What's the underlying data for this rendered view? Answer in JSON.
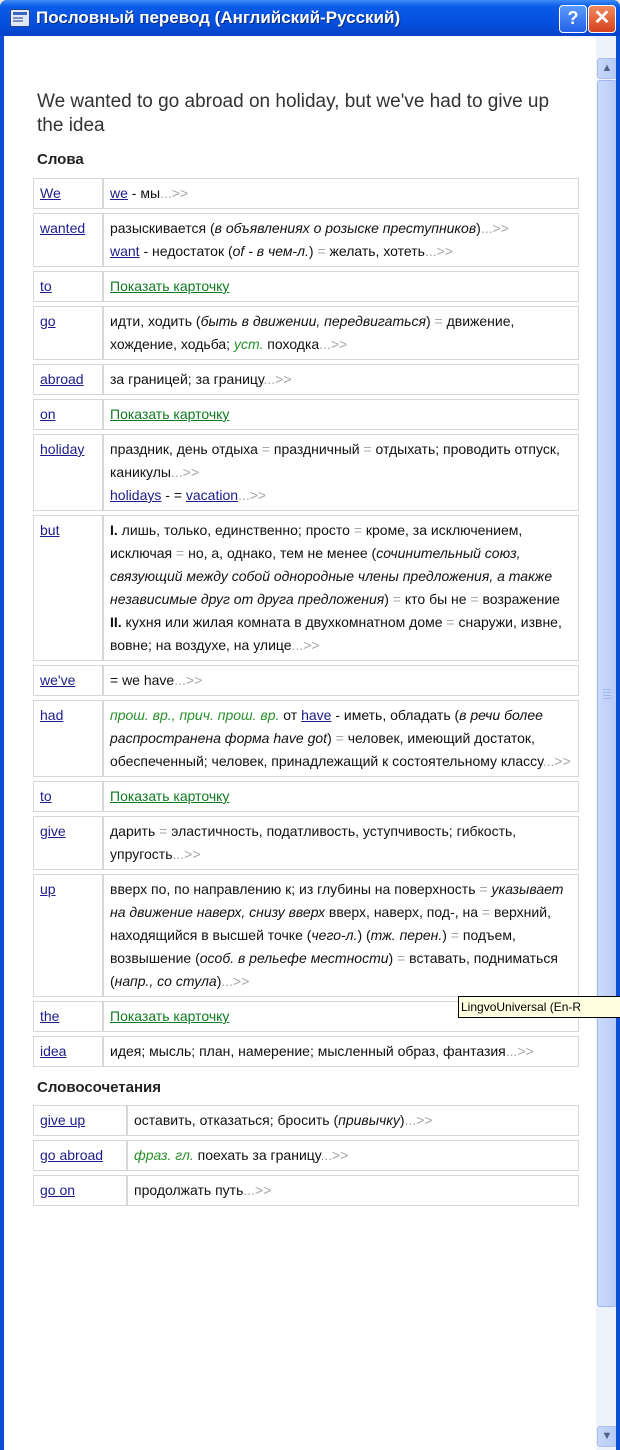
{
  "window": {
    "title": "Пословный перевод (Английский-Русский)",
    "help_button": "?",
    "close_button": "✕"
  },
  "sentence": "We wanted to go abroad on holiday, but we've had to give up the idea",
  "words_header": "Слова",
  "words": [
    {
      "word": "We",
      "tr_html": "<span class=\"lnk\">we</span> - мы<span class=\"more\">...&gt;&gt;</span>"
    },
    {
      "word": "wanted",
      "tr_html": "разыскивается (<i>в объявлениях о розыске преступников</i>)<span class=\"more\">...&gt;&gt;</span><br><span class=\"lnk\">want</span> - недостаток (<i>of - в чем-л.</i>) <span class=\"sep\">=</span> желать, хотеть<span class=\"more\">...&gt;&gt;</span>"
    },
    {
      "word": "to",
      "tr_html": "<span class=\"green\">Показать карточку</span>"
    },
    {
      "word": "go",
      "tr_html": "идти, ходить (<i>быть в движении, передвигаться</i>) <span class=\"sep\">=</span> движение, хождение, ходьба; <span class=\"gi\">уст.</span> походка<span class=\"more\">...&gt;&gt;</span>"
    },
    {
      "word": "abroad",
      "tr_html": "за границей; за границу<span class=\"more\">...&gt;&gt;</span>"
    },
    {
      "word": "on",
      "tr_html": "<span class=\"green\">Показать карточку</span>"
    },
    {
      "word": "holiday",
      "tr_html": "праздник, день отдыха <span class=\"sep\">=</span> праздничный <span class=\"sep\">=</span> отдыхать; проводить отпуск, каникулы<span class=\"more\">...&gt;&gt;</span><br><span class=\"lnk\">holidays</span> - = <span class=\"lnk\">vacation</span><span class=\"more\">...&gt;&gt;</span>"
    },
    {
      "word": "but",
      "tr_html": "<b>I.</b> лишь, только, единственно; просто <span class=\"sep\">=</span> кроме, за исключением, исключая <span class=\"sep\">=</span> но, а, однако, тем не менее (<i>сочинительный союз, связующий между собой однородные члены предложения, а также независимые друг от друга предложения</i>) <span class=\"sep\">=</span> кто бы не <span class=\"sep\">=</span> возражение<br><b>II.</b> кухня или жилая комната в двухкомнатном доме <span class=\"sep\">=</span> снаружи, извне, вовне; на воздухе, на улице<span class=\"more\">...&gt;&gt;</span>"
    },
    {
      "word": "we've",
      "tr_html": "= we have<span class=\"more\">...&gt;&gt;</span>"
    },
    {
      "word": "had",
      "tr_html": "<span class=\"gi\">прош. вр., прич. прош. вр.</span> от <span class=\"lnk\">have</span> - иметь, обладать (<i>в речи более распространена форма have got</i>) <span class=\"sep\">=</span> человек, имеющий достаток, обеспеченный; человек, принадлежащий к состоятельному классу<span class=\"more\">...&gt;&gt;</span>"
    },
    {
      "word": "to",
      "tr_html": "<span class=\"green\">Показать карточку</span>"
    },
    {
      "word": "give",
      "tr_html": "дарить <span class=\"sep\">=</span> эластичность, податливость, уступчивость; гибкость, упругость<span class=\"more\">...&gt;&gt;</span>"
    },
    {
      "word": "up",
      "tr_html": "вверх по, по направлению к; из глубины на поверхность <span class=\"sep\">=</span> <i>указывает на движение наверх, снизу вверх</i> вверх, наверх, под-, на <span class=\"sep\">=</span> верхний, находящийся в высшей точке (<i>чего-л.</i>) (<i>тж. перен.</i>) <span class=\"sep\">=</span> подъем, возвышение (<i>особ. в рельефе местности</i>) <span class=\"sep\">=</span> вставать, подниматься (<i>напр., со стула</i>)<span class=\"more\">...&gt;&gt;</span>"
    },
    {
      "word": "the",
      "tr_html": "<span class=\"green\">Показать карточку</span>"
    },
    {
      "word": "idea",
      "tr_html": "идея; мысль; план, намерение; мысленный образ, фантазия<span class=\"more\">...&gt;&gt;</span>"
    }
  ],
  "phrases_header": "Словосочетания",
  "phrases": [
    {
      "phrase": "give up",
      "tr_html": "оставить, отказаться; бросить (<i>привычку</i>)<span class=\"more\">...&gt;&gt;</span>"
    },
    {
      "phrase": "go abroad",
      "tr_html": "<span class=\"gi\">фраз. гл.</span> поехать за границу<span class=\"more\">...&gt;&gt;</span>"
    },
    {
      "phrase": "go on",
      "tr_html": "продолжать путь<span class=\"more\">...&gt;&gt;</span>"
    }
  ],
  "tooltip": "LingvoUniversal (En-R"
}
